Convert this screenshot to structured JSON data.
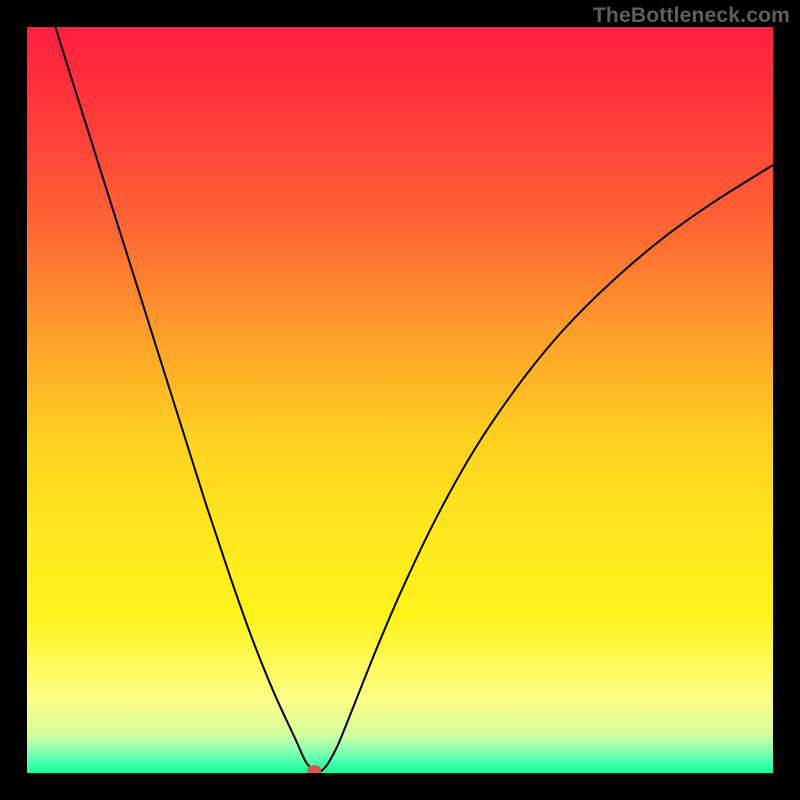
{
  "watermark": "TheBottleneck.com",
  "chart_data": {
    "type": "line",
    "title": "",
    "xlabel": "",
    "ylabel": "",
    "xlim": [
      0,
      100
    ],
    "ylim": [
      0,
      100
    ],
    "grid": false,
    "legend": false,
    "background_gradient": {
      "type": "vertical",
      "stops": [
        {
          "offset": 0.0,
          "color": "#ff1f3f"
        },
        {
          "offset": 0.14,
          "color": "#ff3f3a"
        },
        {
          "offset": 0.28,
          "color": "#ff6a33"
        },
        {
          "offset": 0.42,
          "color": "#ffa22a"
        },
        {
          "offset": 0.55,
          "color": "#ffd021"
        },
        {
          "offset": 0.68,
          "color": "#ffe81e"
        },
        {
          "offset": 0.79,
          "color": "#fff31b"
        },
        {
          "offset": 0.9,
          "color": "#feff87"
        },
        {
          "offset": 0.945,
          "color": "#d8ff9b"
        },
        {
          "offset": 0.965,
          "color": "#9dffb0"
        },
        {
          "offset": 0.985,
          "color": "#4cffb0"
        },
        {
          "offset": 1.0,
          "color": "#14ff95"
        }
      ]
    },
    "series": [
      {
        "name": "bottleneck-curve",
        "color": "#000000",
        "stroke_width": 2,
        "x": [
          3.8,
          6,
          9,
          12,
          15,
          18,
          21,
          24,
          27,
          30,
          33,
          36,
          37.5,
          39,
          40,
          41,
          42,
          44,
          47,
          50,
          54,
          58,
          62,
          67,
          72,
          78,
          85,
          92,
          100
        ],
        "y": [
          100,
          93,
          83.5,
          74,
          64.5,
          55,
          45.5,
          36,
          27,
          18.5,
          11,
          4.5,
          1.3,
          0.2,
          0.8,
          2.4,
          4.5,
          9.5,
          17,
          24,
          32.5,
          40,
          46.5,
          53.5,
          59.5,
          65.5,
          71.5,
          76.5,
          81.5
        ]
      }
    ],
    "markers": [
      {
        "name": "bottleneck-marker",
        "x": 38.5,
        "y": 0.4,
        "color": "#d55a54",
        "rx": 7,
        "ry": 5
      }
    ]
  }
}
